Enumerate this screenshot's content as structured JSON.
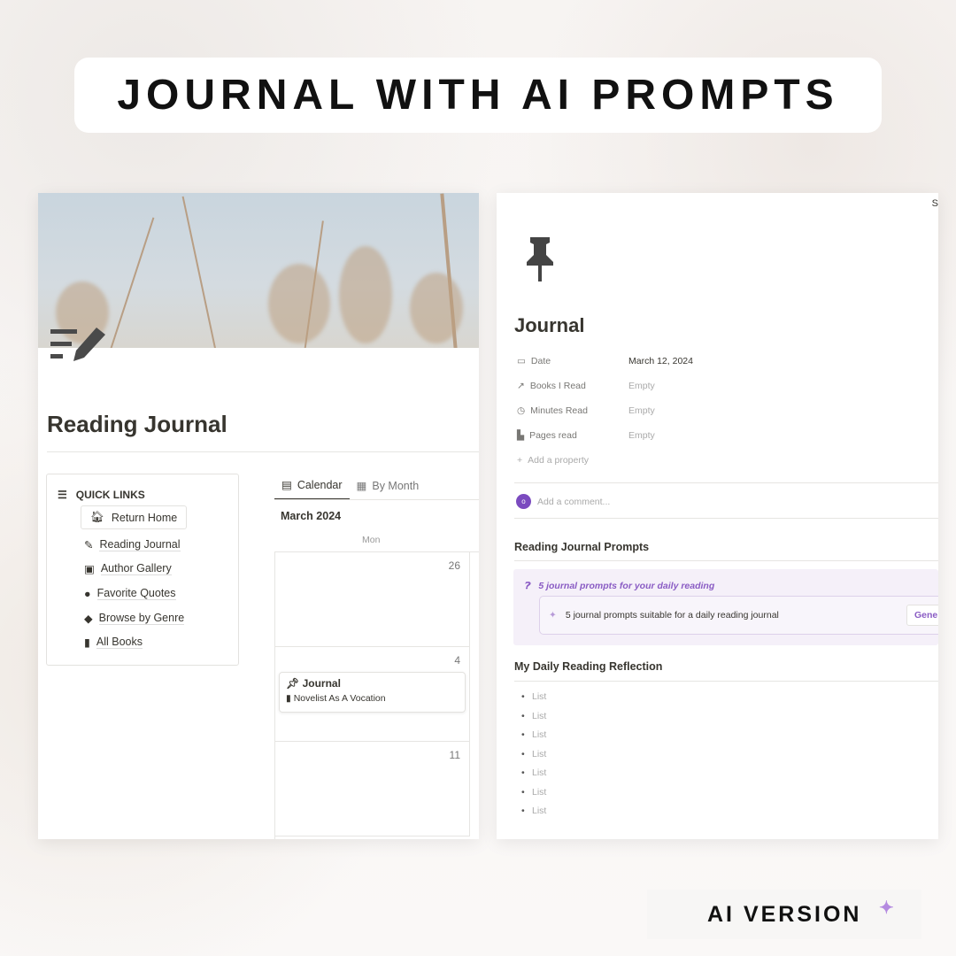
{
  "banner": {
    "title": "JOURNAL WITH AI PROMPTS"
  },
  "left": {
    "page_title": "Reading Journal",
    "page_icon": "write-icon",
    "quick_links": {
      "heading": "QUICK LINKS",
      "return_home": "Return Home",
      "items": [
        {
          "label": "Reading Journal",
          "icon": "write-icon"
        },
        {
          "label": "Author Gallery",
          "icon": "contact-card-icon"
        },
        {
          "label": "Favorite Quotes",
          "icon": "chat-bubble-icon"
        },
        {
          "label": "Browse by Genre",
          "icon": "shapes-icon"
        },
        {
          "label": "All Books",
          "icon": "book-icon"
        }
      ]
    },
    "tabs": [
      {
        "label": "Calendar",
        "active": true
      },
      {
        "label": "By Month",
        "active": false
      }
    ],
    "calendar": {
      "month": "March 2024",
      "weekday": "Mon",
      "days": [
        "26",
        "4",
        "11"
      ],
      "card": {
        "title": "Journal",
        "book": "Novelist As A Vocation"
      }
    }
  },
  "right": {
    "corner_text": "S",
    "page_icon": "pushpin-icon",
    "title": "Journal",
    "properties": [
      {
        "label": "Date",
        "value": "March 12, 2024",
        "icon": "calendar-icon"
      },
      {
        "label": "Books I Read",
        "value": "Empty",
        "icon": "arrow-up-right-icon"
      },
      {
        "label": "Minutes Read",
        "value": "Empty",
        "icon": "clock-icon"
      },
      {
        "label": "Pages read",
        "value": "Empty",
        "icon": "page-icon"
      }
    ],
    "add_property": "Add a property",
    "avatar": "o",
    "comment_placeholder": "Add a comment...",
    "prompts_heading": "Reading Journal Prompts",
    "callout_title": "5 journal prompts for your daily reading",
    "ai_prompt": "5 journal prompts suitable for a daily reading journal",
    "generate_label": "Gene",
    "reflection_heading": "My Daily Reading Reflection",
    "list_items": [
      "List",
      "List",
      "List",
      "List",
      "List",
      "List",
      "List"
    ],
    "accent": "#8a5cc4"
  },
  "badge": {
    "label": "AI VERSION"
  }
}
